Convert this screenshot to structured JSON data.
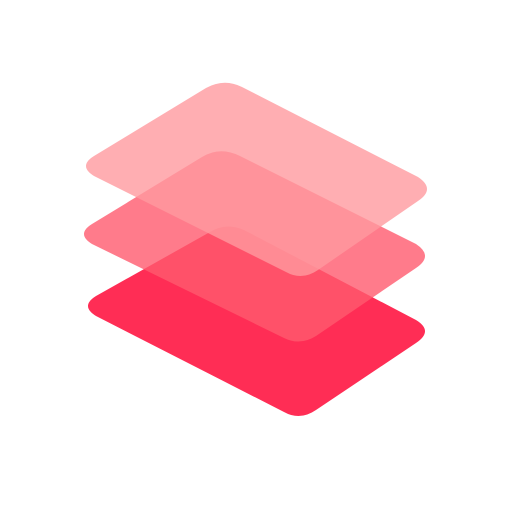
{
  "app_icon": {
    "icon": "stacked-layers-icon",
    "layers": [
      {
        "name": "bottom",
        "color": "#FF2D55",
        "opacity": 1.0
      },
      {
        "name": "middle",
        "color": "#FF5A6E",
        "opacity": 0.8
      },
      {
        "name": "top",
        "color": "#FF9A9F",
        "opacity": 0.8
      }
    ],
    "background": "#FFFFFF"
  }
}
